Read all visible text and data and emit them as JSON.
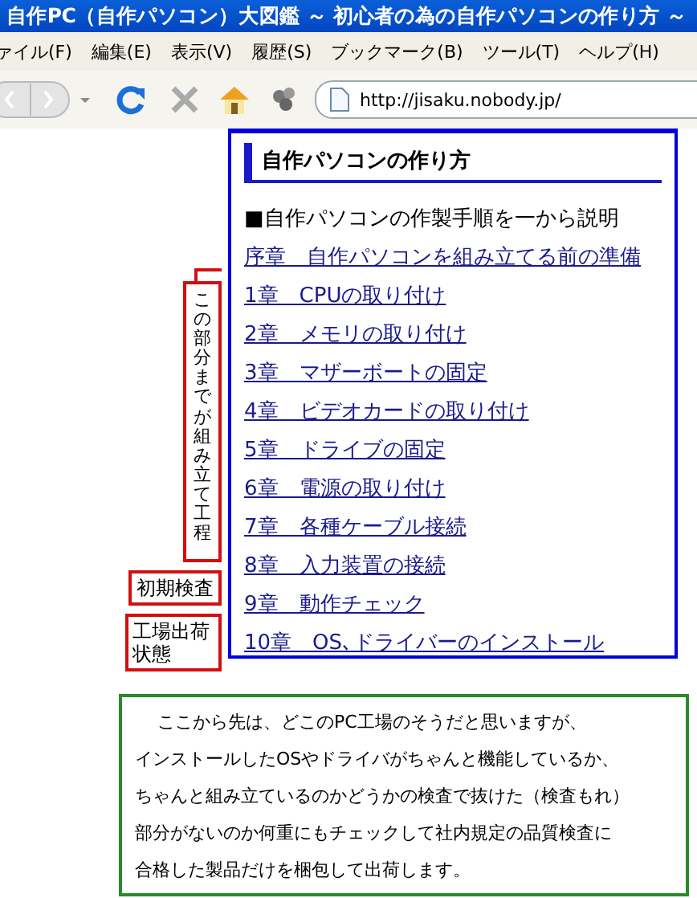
{
  "window": {
    "title": "自作PC（自作パソコン）大図鑑 ～ 初心者の為の自作パソコンの作り方 ～"
  },
  "menu": [
    "ァイル(F)",
    "編集(E)",
    "表示(V)",
    "履歴(S)",
    "ブックマーク(B)",
    "ツール(T)",
    "ヘルプ(H)"
  ],
  "address_bar": {
    "value": "http://jisaku.nobody.jp/"
  },
  "guide": {
    "heading": "自作パソコンの作り方",
    "intro": "■自作パソコンの作製手順を一から説明",
    "links": [
      "序章　自作パソコンを組み立てる前の準備",
      "1章　CPUの取り付け",
      "2章　メモリの取り付け",
      "3章　マザーボートの固定",
      "4章　ビデオカードの取り付け",
      "5章　ドライブの固定",
      "6章　電源の取り付け",
      "7章　各種ケーブル接続",
      "8章　入力装置の接続",
      "9章　動作チェック",
      "10章　OS､ドライバーのインストール"
    ]
  },
  "annotations": [
    {
      "kind": "vertical",
      "text": "この部分までが組み立て工程"
    },
    {
      "kind": "horizontal",
      "text": "初期検査"
    },
    {
      "kind": "horizontal",
      "text": "工場出荷状態"
    }
  ],
  "note": {
    "lines": [
      "ここから先は、どこのPC工場のそうだと思いますが、",
      "インストールしたOSやドライバがちゃんと機能しているか、",
      "ちゃんと組み立ているのかどうかの検査で抜けた（検査もれ）",
      "部分がないのか何重にもチェックして社内規定の品質検査に",
      "合格した製品だけを梱包して出荷します。"
    ]
  }
}
